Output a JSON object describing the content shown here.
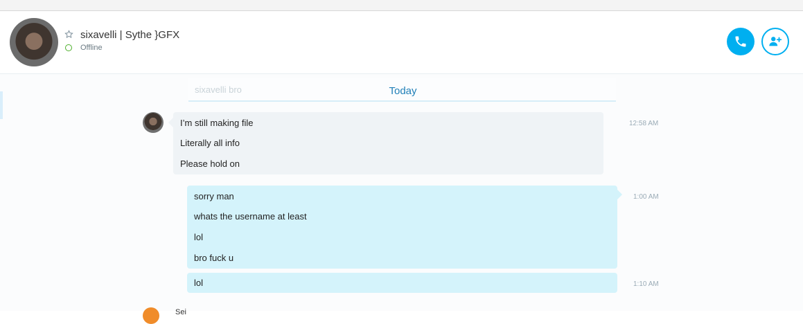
{
  "header": {
    "contact_name": "sixavelli | Sythe }GFX",
    "status": "Offline",
    "status_color": "#4caf2a",
    "accent_color": "#00aff0",
    "star_icon": "star-outline-icon",
    "call_icon": "phone-icon",
    "add_icon": "add-person-icon"
  },
  "divider": {
    "label": "Today",
    "ghost_text": "sixavelli bro"
  },
  "messages": [
    {
      "direction": "incoming",
      "time": "12:58 AM",
      "lines": [
        "I’m still making file",
        "Literally all info",
        "Please hold on"
      ]
    },
    {
      "direction": "outgoing",
      "time": "1:00 AM",
      "lines": [
        "sorry man",
        "whats the username at least",
        "lol",
        "bro fuck u"
      ]
    },
    {
      "direction": "outgoing",
      "time": "1:10 AM",
      "lines": [
        "lol"
      ]
    }
  ],
  "partial_next_sender": "Sei"
}
